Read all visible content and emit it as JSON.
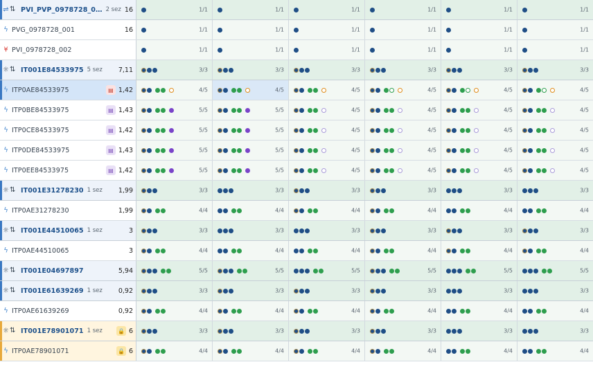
{
  "colors": {
    "accent_blue": "#3a78c2",
    "accent_amber": "#e8a93a",
    "dot_navy": "#1f4e86",
    "dot_green": "#2e9e4e",
    "dot_purple": "#7a44c9",
    "dot_orange": "#df8c1a"
  },
  "rows": [
    {
      "type": "group",
      "id": "r0",
      "icon": "shuffle-icon",
      "icon_color": "#3a78c2",
      "sort_icon": "true",
      "accent": "#3a78c2",
      "label": "PVI_PVP_0978728_0…",
      "sub": "2 sez",
      "badge": null,
      "value": "16",
      "cells": [
        {
          "d": "n",
          "c": "1/1"
        },
        {
          "d": "n",
          "c": "1/1"
        },
        {
          "d": "n",
          "c": "1/1"
        },
        {
          "d": "n",
          "c": "1/1"
        },
        {
          "d": "n",
          "c": "1/1"
        },
        {
          "d": "n",
          "c": "1/1"
        }
      ]
    },
    {
      "type": "item",
      "id": "r1",
      "icon": "bolt-icon",
      "icon_color": "#4a8ad0",
      "accent": "",
      "label": "PVG_0978728_001",
      "sub": "",
      "badge": null,
      "value": "16",
      "cells": [
        {
          "d": "n",
          "c": "1/1"
        },
        {
          "d": "n",
          "c": "1/1"
        },
        {
          "d": "n",
          "c": "1/1"
        },
        {
          "d": "n",
          "c": "1/1"
        },
        {
          "d": "n",
          "c": "1/1"
        },
        {
          "d": "n",
          "c": "1/1"
        }
      ]
    },
    {
      "type": "item",
      "id": "r2",
      "icon": "chevron-double-down-icon",
      "icon_color": "#d9403a",
      "accent": "",
      "label": "PVI_0978728_002",
      "sub": "",
      "badge": null,
      "value": "",
      "cells": [
        {
          "d": "n",
          "c": "1/1"
        },
        {
          "d": "n",
          "c": "1/1"
        },
        {
          "d": "n",
          "c": "1/1"
        },
        {
          "d": "n",
          "c": "1/1"
        },
        {
          "d": "n",
          "c": "1/1"
        },
        {
          "d": "n",
          "c": "1/1"
        }
      ]
    },
    {
      "type": "group",
      "id": "r3",
      "icon": "sun-icon",
      "icon_color": "#3a4a5a",
      "sort_icon": "true",
      "accent": "#3a78c2",
      "label": "IT001E84533975",
      "sub": "5 sez",
      "badge": null,
      "value": "7,11",
      "cells": [
        {
          "d": "onn",
          "c": "3/3"
        },
        {
          "d": "onn",
          "c": "3/3"
        },
        {
          "d": "onn",
          "c": "3/3"
        },
        {
          "d": "onn",
          "c": "3/3"
        },
        {
          "d": "onn",
          "c": "3/3"
        },
        {
          "d": "onn",
          "c": "3/3"
        }
      ]
    },
    {
      "type": "item",
      "id": "r4",
      "icon": "bolt-icon",
      "icon_color": "#4a8ad0",
      "accent": "#3a78c2",
      "selected": "true",
      "label": "ITP0AE84533975",
      "sub": "",
      "badge": {
        "kind": "red",
        "glyph": "doc-icon"
      },
      "value": "1,42",
      "cells": [
        {
          "d": "on|gg|r",
          "c": "4/5"
        },
        {
          "d": "on|gg|r",
          "c": "4/5",
          "hl": "true"
        },
        {
          "d": "on|gg|r",
          "c": "4/5"
        },
        {
          "d": "on|gG|r",
          "c": "4/5"
        },
        {
          "d": "on|gG|r",
          "c": "4/5"
        },
        {
          "d": "on|gG|r",
          "c": "4/5"
        }
      ]
    },
    {
      "type": "item",
      "id": "r5",
      "icon": "bolt-icon",
      "icon_color": "#4a8ad0",
      "accent": "",
      "label": "ITP0BE84533975",
      "sub": "",
      "badge": {
        "kind": "purple",
        "glyph": "doc-icon"
      },
      "value": "1,43",
      "cells": [
        {
          "d": "on|gg|p",
          "c": "5/5"
        },
        {
          "d": "on|gg|p",
          "c": "5/5"
        },
        {
          "d": "on|gg|P",
          "c": "4/5"
        },
        {
          "d": "on|gg|P",
          "c": "4/5"
        },
        {
          "d": "on|gg|P",
          "c": "4/5"
        },
        {
          "d": "on|gg|P",
          "c": "4/5"
        }
      ]
    },
    {
      "type": "item",
      "id": "r6",
      "icon": "bolt-icon",
      "icon_color": "#4a8ad0",
      "accent": "",
      "label": "ITP0CE84533975",
      "sub": "",
      "badge": {
        "kind": "purple",
        "glyph": "doc-icon"
      },
      "value": "1,42",
      "cells": [
        {
          "d": "on|gg|p",
          "c": "5/5"
        },
        {
          "d": "on|gg|p",
          "c": "5/5"
        },
        {
          "d": "on|gg|P",
          "c": "4/5"
        },
        {
          "d": "on|gg|P",
          "c": "4/5"
        },
        {
          "d": "on|gg|P",
          "c": "4/5"
        },
        {
          "d": "on|gg|P",
          "c": "4/5"
        }
      ]
    },
    {
      "type": "item",
      "id": "r7",
      "icon": "bolt-icon",
      "icon_color": "#4a8ad0",
      "accent": "",
      "label": "ITP0DE84533975",
      "sub": "",
      "badge": {
        "kind": "purple",
        "glyph": "doc-icon"
      },
      "value": "1,43",
      "cells": [
        {
          "d": "on|gg|p",
          "c": "5/5"
        },
        {
          "d": "on|gg|p",
          "c": "5/5"
        },
        {
          "d": "on|gg|P",
          "c": "4/5"
        },
        {
          "d": "on|gg|P",
          "c": "4/5"
        },
        {
          "d": "on|gg|P",
          "c": "4/5"
        },
        {
          "d": "on|gg|P",
          "c": "4/5"
        }
      ]
    },
    {
      "type": "item",
      "id": "r8",
      "icon": "bolt-icon",
      "icon_color": "#4a8ad0",
      "accent": "",
      "label": "ITP0EE84533975",
      "sub": "",
      "badge": {
        "kind": "purple",
        "glyph": "doc-icon"
      },
      "value": "1,42",
      "cells": [
        {
          "d": "on|gg|p",
          "c": "5/5"
        },
        {
          "d": "on|gg|p",
          "c": "5/5"
        },
        {
          "d": "on|gg|P",
          "c": "4/5"
        },
        {
          "d": "on|gg|P",
          "c": "4/5"
        },
        {
          "d": "on|gg|P",
          "c": "4/5"
        },
        {
          "d": "on|gg|P",
          "c": "4/5"
        }
      ]
    },
    {
      "type": "group",
      "id": "r9",
      "icon": "sun-icon",
      "icon_color": "#3a4a5a",
      "sort_icon": "true",
      "accent": "#3a78c2",
      "label": "IT001E31278230",
      "sub": "1 sez",
      "badge": null,
      "value": "1,99",
      "cells": [
        {
          "d": "onn",
          "c": "3/3"
        },
        {
          "d": "nnn",
          "c": "3/3"
        },
        {
          "d": "onn",
          "c": "3/3"
        },
        {
          "d": "onn",
          "c": "3/3"
        },
        {
          "d": "nnn",
          "c": "3/3"
        },
        {
          "d": "nnn",
          "c": "3/3"
        }
      ]
    },
    {
      "type": "item",
      "id": "r10",
      "icon": "bolt-icon",
      "icon_color": "#4a8ad0",
      "accent": "",
      "label": "ITP0AE31278230",
      "sub": "",
      "badge": null,
      "value": "1,99",
      "cells": [
        {
          "d": "on|gg",
          "c": "4/4"
        },
        {
          "d": "nn|gg",
          "c": "4/4"
        },
        {
          "d": "on|gg",
          "c": "4/4"
        },
        {
          "d": "on|gg",
          "c": "4/4"
        },
        {
          "d": "nn|gg",
          "c": "4/4"
        },
        {
          "d": "nn|gg",
          "c": "4/4"
        }
      ]
    },
    {
      "type": "group",
      "id": "r11",
      "icon": "sun-icon",
      "icon_color": "#3a4a5a",
      "sort_icon": "true",
      "accent": "#3a78c2",
      "label": "IT001E44510065",
      "sub": "1 sez",
      "badge": null,
      "value": "3",
      "cells": [
        {
          "d": "onn",
          "c": "3/3"
        },
        {
          "d": "nnn",
          "c": "3/3"
        },
        {
          "d": "nnn",
          "c": "3/3"
        },
        {
          "d": "onn",
          "c": "3/3"
        },
        {
          "d": "onn",
          "c": "3/3"
        },
        {
          "d": "onn",
          "c": "3/3"
        }
      ]
    },
    {
      "type": "item",
      "id": "r12",
      "icon": "bolt-icon",
      "icon_color": "#4a8ad0",
      "accent": "",
      "label": "ITP0AE44510065",
      "sub": "",
      "badge": null,
      "value": "3",
      "cells": [
        {
          "d": "on|gg",
          "c": "4/4"
        },
        {
          "d": "nn|gg",
          "c": "4/4"
        },
        {
          "d": "nn|gg",
          "c": "4/4"
        },
        {
          "d": "on|gg",
          "c": "4/4"
        },
        {
          "d": "on|gg",
          "c": "4/4"
        },
        {
          "d": "on|gg",
          "c": "4/4"
        }
      ]
    },
    {
      "type": "group",
      "id": "r13",
      "icon": "sun-icon",
      "icon_color": "#3a4a5a",
      "sort_icon": "true",
      "accent": "#3a78c2",
      "label": "IT001E04697897",
      "sub": "",
      "badge": null,
      "value": "5,94",
      "cells": [
        {
          "d": "onn|gg",
          "c": "5/5"
        },
        {
          "d": "onn|gg",
          "c": "5/5"
        },
        {
          "d": "nnn|gg",
          "c": "5/5"
        },
        {
          "d": "onn|gg",
          "c": "5/5"
        },
        {
          "d": "nnn|gg",
          "c": "5/5"
        },
        {
          "d": "nnn|gg",
          "c": "5/5"
        }
      ]
    },
    {
      "type": "group",
      "id": "r14",
      "icon": "sun-icon",
      "icon_color": "#3a4a5a",
      "sort_icon": "true",
      "accent": "#3a78c2",
      "label": "IT001E61639269",
      "sub": "1 sez",
      "badge": null,
      "value": "0,92",
      "cells": [
        {
          "d": "onn",
          "c": "3/3"
        },
        {
          "d": "onn",
          "c": "3/3"
        },
        {
          "d": "onn",
          "c": "3/3"
        },
        {
          "d": "onn",
          "c": "3/3"
        },
        {
          "d": "nnn",
          "c": "3/3"
        },
        {
          "d": "nnn",
          "c": "3/3"
        }
      ]
    },
    {
      "type": "item",
      "id": "r15",
      "icon": "bolt-icon",
      "icon_color": "#4a8ad0",
      "accent": "",
      "label": "ITP0AE61639269",
      "sub": "",
      "badge": null,
      "value": "0,92",
      "cells": [
        {
          "d": "on|gg",
          "c": "4/4"
        },
        {
          "d": "on|gg",
          "c": "4/4"
        },
        {
          "d": "on|gg",
          "c": "4/4"
        },
        {
          "d": "on|gg",
          "c": "4/4"
        },
        {
          "d": "nn|gg",
          "c": "4/4"
        },
        {
          "d": "nn|gg",
          "c": "4/4"
        }
      ]
    },
    {
      "type": "group",
      "id": "r16",
      "icon": "sun-icon",
      "icon_color": "#3a4a5a",
      "sort_icon": "true",
      "accent": "#e8a93a",
      "warn": "true",
      "label": "IT001E78901071",
      "sub": "1 sez",
      "badge": {
        "kind": "lock",
        "glyph": "lock-icon"
      },
      "value": "6",
      "cells": [
        {
          "d": "onn",
          "c": "3/3"
        },
        {
          "d": "onn",
          "c": "3/3"
        },
        {
          "d": "onn",
          "c": "3/3"
        },
        {
          "d": "onn",
          "c": "3/3"
        },
        {
          "d": "nnn",
          "c": "3/3"
        },
        {
          "d": "nnn",
          "c": "3/3"
        }
      ]
    },
    {
      "type": "item",
      "id": "r17",
      "icon": "bolt-icon",
      "icon_color": "#4a8ad0",
      "accent": "#e8a93a",
      "warn": "true",
      "label": "ITP0AE78901071",
      "sub": "",
      "badge": {
        "kind": "lock",
        "glyph": "lock-icon"
      },
      "value": "6",
      "cells": [
        {
          "d": "on|gg",
          "c": "4/4"
        },
        {
          "d": "on|gg",
          "c": "4/4"
        },
        {
          "d": "on|gg",
          "c": "4/4"
        },
        {
          "d": "on|gg",
          "c": "4/4"
        },
        {
          "d": "nn|gg",
          "c": "4/4"
        },
        {
          "d": "nn|gg",
          "c": "4/4"
        }
      ]
    }
  ]
}
